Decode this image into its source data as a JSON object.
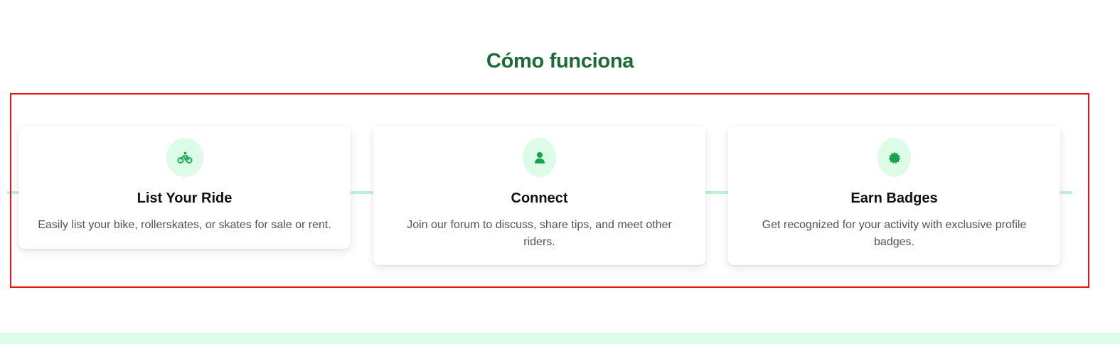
{
  "section": {
    "title": "Cómo funciona"
  },
  "colors": {
    "title": "#1c6b36",
    "accent": "#16a34a",
    "icon_bg": "#dcfce7",
    "connector": "#bdf2d1",
    "highlight_frame": "#e8161b"
  },
  "steps": [
    {
      "icon": "bicycle-icon",
      "title": "List Your Ride",
      "description": "Easily list your bike, rollerskates, or skates for sale or rent."
    },
    {
      "icon": "user-icon",
      "title": "Connect",
      "description": "Join our forum to discuss, share tips, and meet other riders."
    },
    {
      "icon": "badge-icon",
      "title": "Earn Badges",
      "description": "Get recognized for your activity with exclusive profile badges."
    }
  ]
}
